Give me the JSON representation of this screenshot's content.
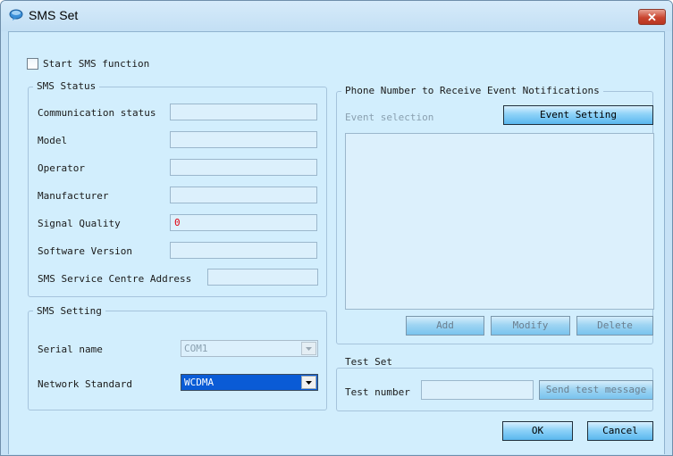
{
  "window": {
    "title": "SMS Set",
    "close_label": "✕"
  },
  "start_sms": {
    "label": "Start SMS function",
    "checked": false
  },
  "sms_status": {
    "title": "SMS Status",
    "rows": [
      {
        "label": "Communication status",
        "value": ""
      },
      {
        "label": "Model",
        "value": ""
      },
      {
        "label": "Operator",
        "value": ""
      },
      {
        "label": "Manufacturer",
        "value": ""
      },
      {
        "label": "Signal Quality",
        "value": "0"
      },
      {
        "label": "Software Version",
        "value": ""
      },
      {
        "label": "SMS Service Centre Address",
        "value": ""
      }
    ]
  },
  "sms_setting": {
    "title": "SMS Setting",
    "serial_label": "Serial name",
    "serial_value": "COM1",
    "network_label": "Network Standard",
    "network_value": "WCDMA"
  },
  "notifications": {
    "title": "Phone Number to Receive Event Notifications",
    "event_selection_label": "Event selection",
    "event_setting_button": "Event Setting",
    "add_button": "Add",
    "modify_button": "Modify",
    "delete_button": "Delete"
  },
  "test_set": {
    "title": "Test Set",
    "test_number_label": "Test number",
    "test_number_value": "",
    "send_button": "Send test message"
  },
  "footer": {
    "ok_button": "OK",
    "cancel_button": "Cancel"
  },
  "colors": {
    "accent": "#5ab7ee",
    "background": "#d2eefd",
    "selection": "#0a5bd6",
    "error_text": "#e0000f"
  }
}
